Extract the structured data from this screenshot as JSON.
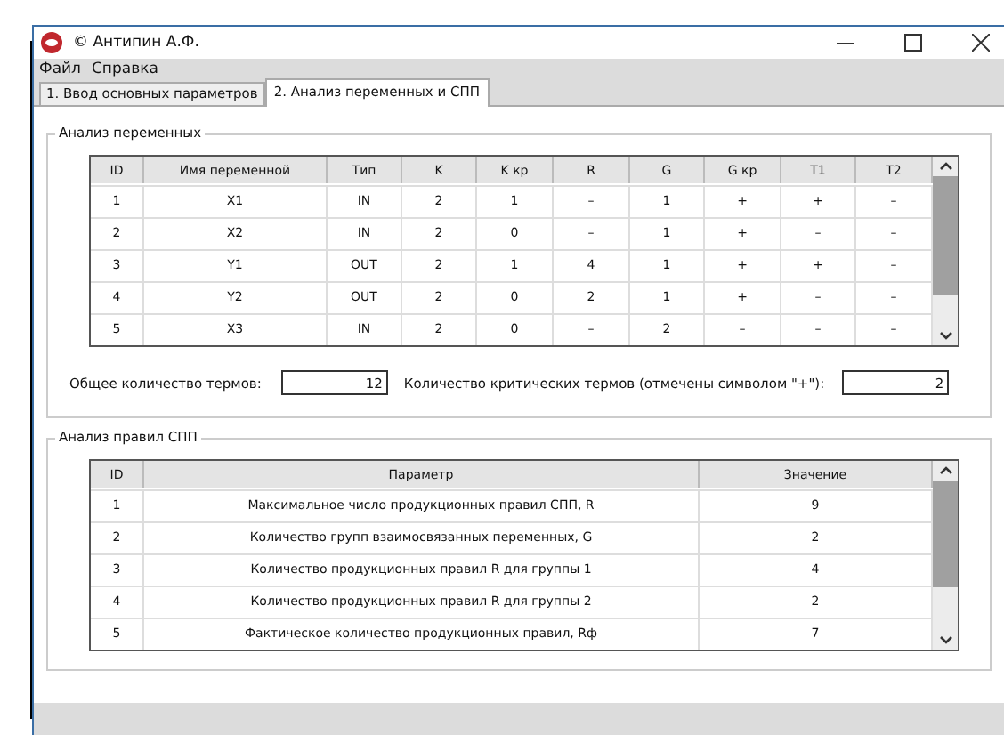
{
  "window": {
    "title": "© Антипин А.Ф."
  },
  "menu": [
    "Файл",
    "Справка"
  ],
  "tabs": [
    {
      "label": "1. Ввод основных параметров",
      "selected": false
    },
    {
      "label": "2. Анализ переменных и СПП",
      "selected": true
    }
  ],
  "variables": {
    "title": "Анализ переменных",
    "columns": [
      "ID",
      "Имя переменной",
      "Тип",
      "K",
      "K кр",
      "R",
      "G",
      "G кр",
      "T1",
      "T2"
    ],
    "rows": [
      [
        "1",
        "X1",
        "IN",
        "2",
        "1",
        "–",
        "1",
        "+",
        "+",
        "–"
      ],
      [
        "2",
        "X2",
        "IN",
        "2",
        "0",
        "–",
        "1",
        "+",
        "–",
        "–"
      ],
      [
        "3",
        "Y1",
        "OUT",
        "2",
        "1",
        "4",
        "1",
        "+",
        "+",
        "–"
      ],
      [
        "4",
        "Y2",
        "OUT",
        "2",
        "0",
        "2",
        "1",
        "+",
        "–",
        "–"
      ],
      [
        "5",
        "X3",
        "IN",
        "2",
        "0",
        "–",
        "2",
        "–",
        "–",
        "–"
      ]
    ],
    "total_label": "Общее количество термов:",
    "total_value": "12",
    "critical_label": "Количество критических термов (отмечены символом \"+\"):",
    "critical_value": "2"
  },
  "rules": {
    "title": "Анализ правил СПП",
    "columns": [
      "ID",
      "Параметр",
      "Значение"
    ],
    "rows": [
      [
        "1",
        "Максимальное число продукционных правил СПП, R",
        "9"
      ],
      [
        "2",
        "Количество групп взаимосвязанных переменных, G",
        "2"
      ],
      [
        "3",
        "Количество продукционных правил R для группы 1",
        "4"
      ],
      [
        "4",
        "Количество продукционных правил R для группы 2",
        "2"
      ],
      [
        "5",
        "Фактическое количество продукционных правил, Rф",
        "7"
      ]
    ]
  }
}
